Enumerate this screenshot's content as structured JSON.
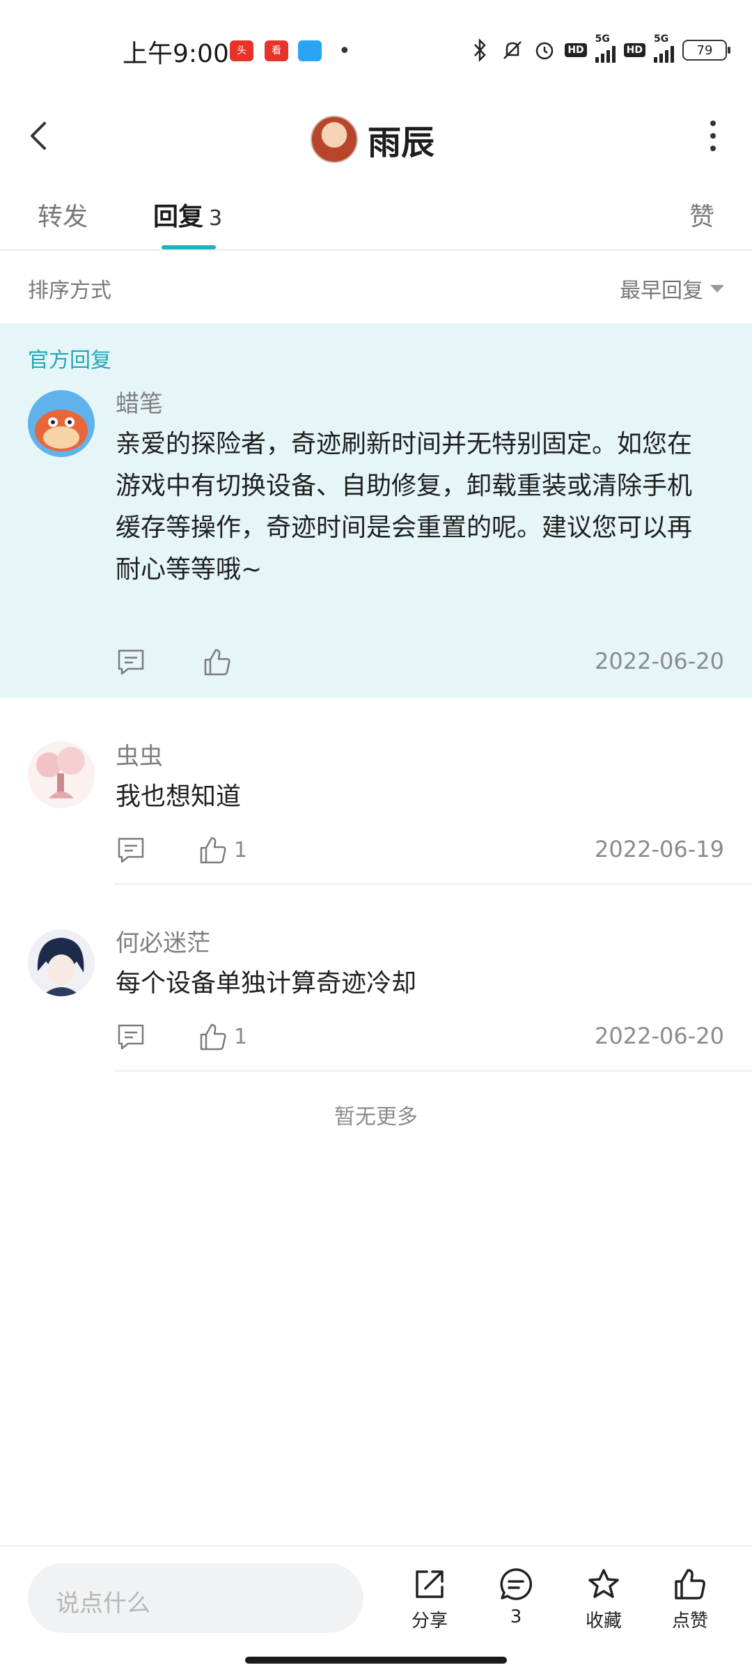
{
  "status_bar": {
    "time": "上午9:00",
    "battery": "79",
    "network_labels": [
      "HD",
      "5G",
      "HD",
      "5G"
    ]
  },
  "header": {
    "title": "雨辰"
  },
  "tabs": [
    {
      "label": "转发"
    },
    {
      "label": "回复",
      "count": "3"
    },
    {
      "label": "赞"
    }
  ],
  "sort": {
    "label": "排序方式",
    "value": "最早回复"
  },
  "official_tag": "官方回复",
  "comments": [
    {
      "username": "蜡笔",
      "lines": [
        "亲爱的探险者，奇迹刷新时间并无特别固定。如您在",
        "游戏中有切换设备、自助修复，卸载重装或清除手机",
        "缓存等操作，奇迹时间是会重置的呢。建议您可以再",
        "耐心等等哦~"
      ],
      "likes": "",
      "date": "2022-06-20"
    },
    {
      "username": "虫虫",
      "lines": [
        "我也想知道"
      ],
      "likes": "1",
      "date": "2022-06-19"
    },
    {
      "username": "何必迷茫",
      "lines": [
        "每个设备单独计算奇迹冷却"
      ],
      "likes": "1",
      "date": "2022-06-20"
    }
  ],
  "no_more": "暂无更多",
  "bottom_bar": {
    "input_placeholder": "说点什么",
    "share_label": "分享",
    "comment_count": "3",
    "favorite_label": "收藏",
    "like_label": "点赞"
  }
}
